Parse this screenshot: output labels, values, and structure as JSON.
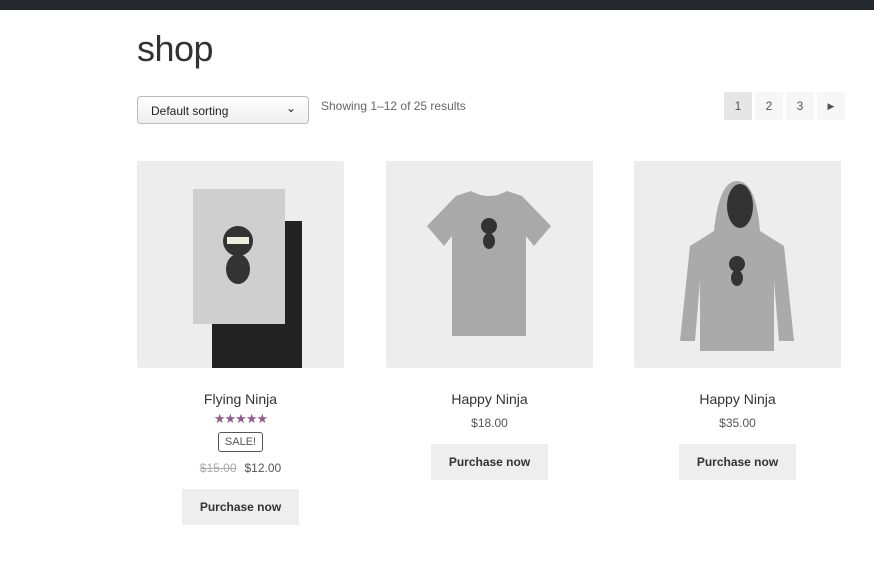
{
  "page": {
    "title": "shop"
  },
  "toolbar": {
    "sort_value": "Default sorting",
    "result_count": "Showing 1–12 of 25 results"
  },
  "pagination": {
    "pages": [
      "1",
      "2",
      "3"
    ],
    "current": "1",
    "next_icon": "triangle-right-icon"
  },
  "colors": {
    "star": "#96588a",
    "topbar": "#23282d"
  },
  "products": [
    {
      "name": "Flying Ninja",
      "rating": 5,
      "stars": "★★★★★",
      "badge": "SALE!",
      "old_price": "$15.00",
      "price": "$12.00",
      "button": "Purchase now"
    },
    {
      "name": "Happy Ninja",
      "price": "$18.00",
      "button": "Purchase now"
    },
    {
      "name": "Happy Ninja",
      "price": "$35.00",
      "button": "Purchase now"
    }
  ]
}
